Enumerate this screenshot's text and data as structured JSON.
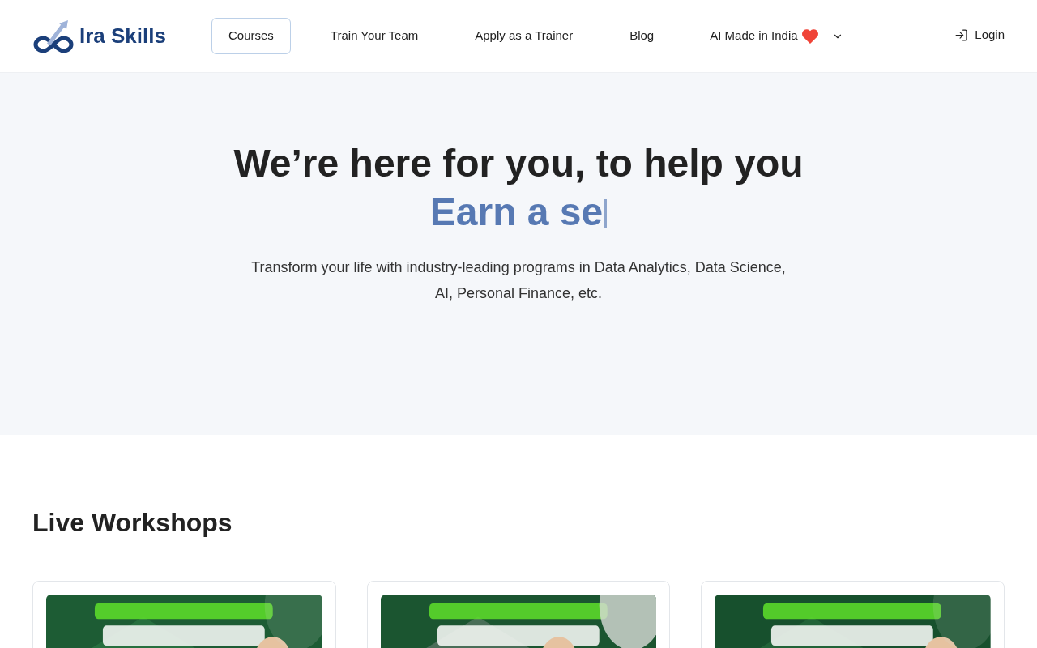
{
  "header": {
    "logo": "Ira Skills",
    "nav": [
      {
        "label": "Courses",
        "selected": true
      },
      {
        "label": "Train Your Team",
        "selected": false
      },
      {
        "label": "Apply as a Trainer",
        "selected": false
      },
      {
        "label": "Blog",
        "selected": false
      }
    ],
    "dropdown": {
      "label": "AI Made in India",
      "expanded": false
    },
    "login": "Login"
  },
  "hero": {
    "title": "We’re here for you, to help you",
    "typed": "Earn a se",
    "subtitle": "Transform your life with industry-leading programs in Data Analytics, Data Science, AI, Personal Finance, etc."
  },
  "section": {
    "title": "Live Workshops"
  }
}
